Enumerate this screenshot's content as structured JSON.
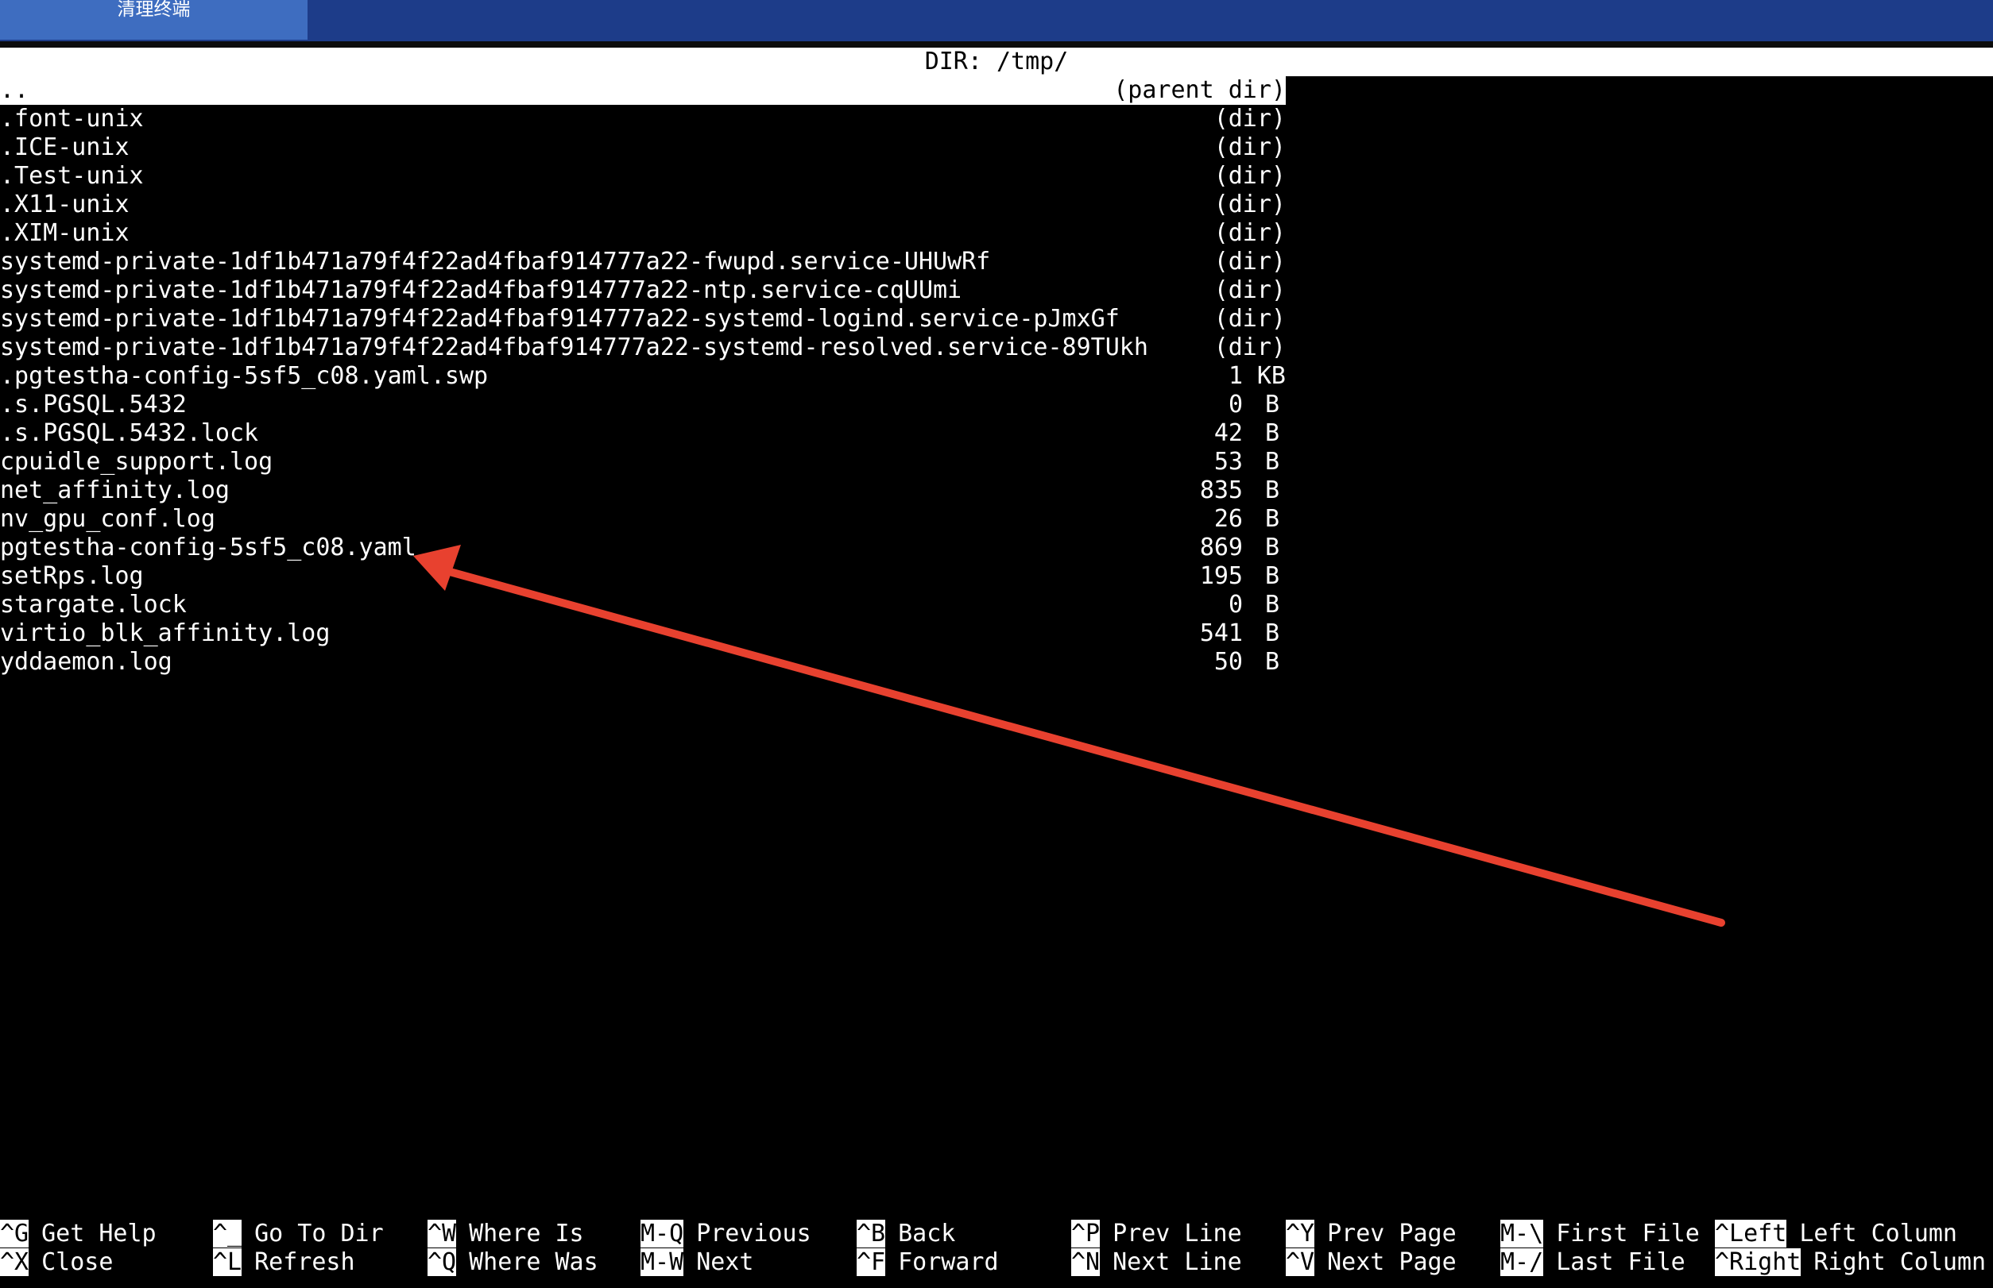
{
  "toolbar": {
    "clear_label": "清理终端"
  },
  "browser": {
    "title": "DIR: /tmp/",
    "parent": {
      "name": "..",
      "info": "(parent dir)"
    },
    "entries": [
      {
        "name": ".font-unix",
        "num": "",
        "unit": "(dir)"
      },
      {
        "name": ".ICE-unix",
        "num": "",
        "unit": "(dir)"
      },
      {
        "name": ".Test-unix",
        "num": "",
        "unit": "(dir)"
      },
      {
        "name": ".X11-unix",
        "num": "",
        "unit": "(dir)"
      },
      {
        "name": ".XIM-unix",
        "num": "",
        "unit": "(dir)"
      },
      {
        "name": "systemd-private-1df1b471a79f4f22ad4fbaf914777a22-fwupd.service-UHUwRf",
        "num": "",
        "unit": "(dir)"
      },
      {
        "name": "systemd-private-1df1b471a79f4f22ad4fbaf914777a22-ntp.service-cqUUmi",
        "num": "",
        "unit": "(dir)"
      },
      {
        "name": "systemd-private-1df1b471a79f4f22ad4fbaf914777a22-systemd-logind.service-pJmxGf",
        "num": "",
        "unit": "(dir)"
      },
      {
        "name": "systemd-private-1df1b471a79f4f22ad4fbaf914777a22-systemd-resolved.service-89TUkh",
        "num": "",
        "unit": "(dir)"
      },
      {
        "name": ".pgtestha-config-5sf5_c08.yaml.swp",
        "num": "1",
        "unit": "KB"
      },
      {
        "name": ".s.PGSQL.5432",
        "num": "0",
        "unit": "B"
      },
      {
        "name": ".s.PGSQL.5432.lock",
        "num": "42",
        "unit": "B"
      },
      {
        "name": "cpuidle_support.log",
        "num": "53",
        "unit": "B"
      },
      {
        "name": "net_affinity.log",
        "num": "835",
        "unit": "B"
      },
      {
        "name": "nv_gpu_conf.log",
        "num": "26",
        "unit": "B"
      },
      {
        "name": "pgtestha-config-5sf5_c08.yaml",
        "num": "869",
        "unit": "B"
      },
      {
        "name": "setRps.log",
        "num": "195",
        "unit": "B"
      },
      {
        "name": "stargate.lock",
        "num": "0",
        "unit": "B"
      },
      {
        "name": "virtio_blk_affinity.log",
        "num": "541",
        "unit": "B"
      },
      {
        "name": "yddaemon.log",
        "num": "50",
        "unit": "B"
      }
    ]
  },
  "shortcuts": [
    {
      "key": "^G",
      "label": "Get Help"
    },
    {
      "key": "^X",
      "label": "Close"
    },
    {
      "key": "^_",
      "label": "Go To Dir"
    },
    {
      "key": "^L",
      "label": "Refresh"
    },
    {
      "key": "^W",
      "label": "Where Is"
    },
    {
      "key": "^Q",
      "label": "Where Was"
    },
    {
      "key": "M-Q",
      "label": "Previous"
    },
    {
      "key": "M-W",
      "label": "Next"
    },
    {
      "key": "^B",
      "label": "Back"
    },
    {
      "key": "^F",
      "label": "Forward"
    },
    {
      "key": "^P",
      "label": "Prev Line"
    },
    {
      "key": "^N",
      "label": "Next Line"
    },
    {
      "key": "^Y",
      "label": "Prev Page"
    },
    {
      "key": "^V",
      "label": "Next Page"
    },
    {
      "key": "M-\\",
      "label": "First File"
    },
    {
      "key": "M-/",
      "label": "Last File"
    },
    {
      "key": "^Left",
      "label": "Left Column"
    },
    {
      "key": "^Right",
      "label": "Right Column"
    }
  ],
  "colors": {
    "topbar": "#1d3c89",
    "button": "#3e6dc0",
    "arrow": "#e8412f"
  }
}
